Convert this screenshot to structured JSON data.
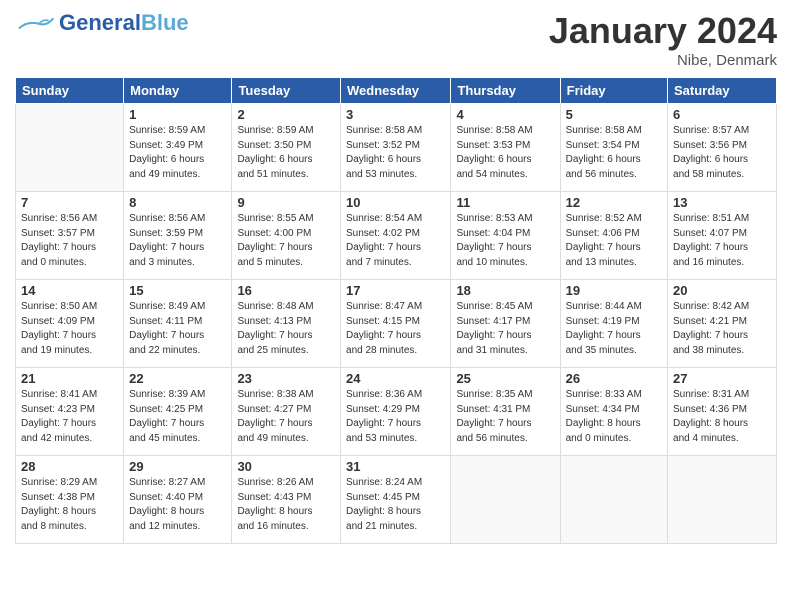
{
  "logo": {
    "text1": "General",
    "text2": "Blue"
  },
  "title": "January 2024",
  "location": "Nibe, Denmark",
  "days_header": [
    "Sunday",
    "Monday",
    "Tuesday",
    "Wednesday",
    "Thursday",
    "Friday",
    "Saturday"
  ],
  "weeks": [
    [
      {
        "num": "",
        "detail": ""
      },
      {
        "num": "1",
        "detail": "Sunrise: 8:59 AM\nSunset: 3:49 PM\nDaylight: 6 hours\nand 49 minutes."
      },
      {
        "num": "2",
        "detail": "Sunrise: 8:59 AM\nSunset: 3:50 PM\nDaylight: 6 hours\nand 51 minutes."
      },
      {
        "num": "3",
        "detail": "Sunrise: 8:58 AM\nSunset: 3:52 PM\nDaylight: 6 hours\nand 53 minutes."
      },
      {
        "num": "4",
        "detail": "Sunrise: 8:58 AM\nSunset: 3:53 PM\nDaylight: 6 hours\nand 54 minutes."
      },
      {
        "num": "5",
        "detail": "Sunrise: 8:58 AM\nSunset: 3:54 PM\nDaylight: 6 hours\nand 56 minutes."
      },
      {
        "num": "6",
        "detail": "Sunrise: 8:57 AM\nSunset: 3:56 PM\nDaylight: 6 hours\nand 58 minutes."
      }
    ],
    [
      {
        "num": "7",
        "detail": "Sunrise: 8:56 AM\nSunset: 3:57 PM\nDaylight: 7 hours\nand 0 minutes."
      },
      {
        "num": "8",
        "detail": "Sunrise: 8:56 AM\nSunset: 3:59 PM\nDaylight: 7 hours\nand 3 minutes."
      },
      {
        "num": "9",
        "detail": "Sunrise: 8:55 AM\nSunset: 4:00 PM\nDaylight: 7 hours\nand 5 minutes."
      },
      {
        "num": "10",
        "detail": "Sunrise: 8:54 AM\nSunset: 4:02 PM\nDaylight: 7 hours\nand 7 minutes."
      },
      {
        "num": "11",
        "detail": "Sunrise: 8:53 AM\nSunset: 4:04 PM\nDaylight: 7 hours\nand 10 minutes."
      },
      {
        "num": "12",
        "detail": "Sunrise: 8:52 AM\nSunset: 4:06 PM\nDaylight: 7 hours\nand 13 minutes."
      },
      {
        "num": "13",
        "detail": "Sunrise: 8:51 AM\nSunset: 4:07 PM\nDaylight: 7 hours\nand 16 minutes."
      }
    ],
    [
      {
        "num": "14",
        "detail": "Sunrise: 8:50 AM\nSunset: 4:09 PM\nDaylight: 7 hours\nand 19 minutes."
      },
      {
        "num": "15",
        "detail": "Sunrise: 8:49 AM\nSunset: 4:11 PM\nDaylight: 7 hours\nand 22 minutes."
      },
      {
        "num": "16",
        "detail": "Sunrise: 8:48 AM\nSunset: 4:13 PM\nDaylight: 7 hours\nand 25 minutes."
      },
      {
        "num": "17",
        "detail": "Sunrise: 8:47 AM\nSunset: 4:15 PM\nDaylight: 7 hours\nand 28 minutes."
      },
      {
        "num": "18",
        "detail": "Sunrise: 8:45 AM\nSunset: 4:17 PM\nDaylight: 7 hours\nand 31 minutes."
      },
      {
        "num": "19",
        "detail": "Sunrise: 8:44 AM\nSunset: 4:19 PM\nDaylight: 7 hours\nand 35 minutes."
      },
      {
        "num": "20",
        "detail": "Sunrise: 8:42 AM\nSunset: 4:21 PM\nDaylight: 7 hours\nand 38 minutes."
      }
    ],
    [
      {
        "num": "21",
        "detail": "Sunrise: 8:41 AM\nSunset: 4:23 PM\nDaylight: 7 hours\nand 42 minutes."
      },
      {
        "num": "22",
        "detail": "Sunrise: 8:39 AM\nSunset: 4:25 PM\nDaylight: 7 hours\nand 45 minutes."
      },
      {
        "num": "23",
        "detail": "Sunrise: 8:38 AM\nSunset: 4:27 PM\nDaylight: 7 hours\nand 49 minutes."
      },
      {
        "num": "24",
        "detail": "Sunrise: 8:36 AM\nSunset: 4:29 PM\nDaylight: 7 hours\nand 53 minutes."
      },
      {
        "num": "25",
        "detail": "Sunrise: 8:35 AM\nSunset: 4:31 PM\nDaylight: 7 hours\nand 56 minutes."
      },
      {
        "num": "26",
        "detail": "Sunrise: 8:33 AM\nSunset: 4:34 PM\nDaylight: 8 hours\nand 0 minutes."
      },
      {
        "num": "27",
        "detail": "Sunrise: 8:31 AM\nSunset: 4:36 PM\nDaylight: 8 hours\nand 4 minutes."
      }
    ],
    [
      {
        "num": "28",
        "detail": "Sunrise: 8:29 AM\nSunset: 4:38 PM\nDaylight: 8 hours\nand 8 minutes."
      },
      {
        "num": "29",
        "detail": "Sunrise: 8:27 AM\nSunset: 4:40 PM\nDaylight: 8 hours\nand 12 minutes."
      },
      {
        "num": "30",
        "detail": "Sunrise: 8:26 AM\nSunset: 4:43 PM\nDaylight: 8 hours\nand 16 minutes."
      },
      {
        "num": "31",
        "detail": "Sunrise: 8:24 AM\nSunset: 4:45 PM\nDaylight: 8 hours\nand 21 minutes."
      },
      {
        "num": "",
        "detail": ""
      },
      {
        "num": "",
        "detail": ""
      },
      {
        "num": "",
        "detail": ""
      }
    ]
  ]
}
